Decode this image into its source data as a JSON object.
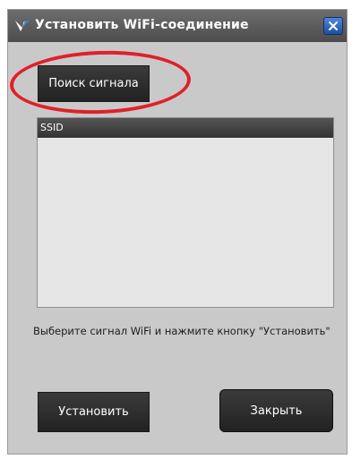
{
  "window": {
    "title": "Установить WiFi-соединение"
  },
  "buttons": {
    "search_label": "Поиск сигнала",
    "install_label": "Установить",
    "close_label": "Закрыть"
  },
  "list": {
    "column_header": "SSID",
    "items": []
  },
  "hint_text": "Выберите сигнал WiFi и нажмите кнопку \"Установить\"",
  "colors": {
    "window_bg": "#c9c9c9",
    "titlebar": "#555555",
    "button_dark": "#2e2e2e",
    "highlight": "#e0202a",
    "close_blue": "#2a5fb8"
  }
}
